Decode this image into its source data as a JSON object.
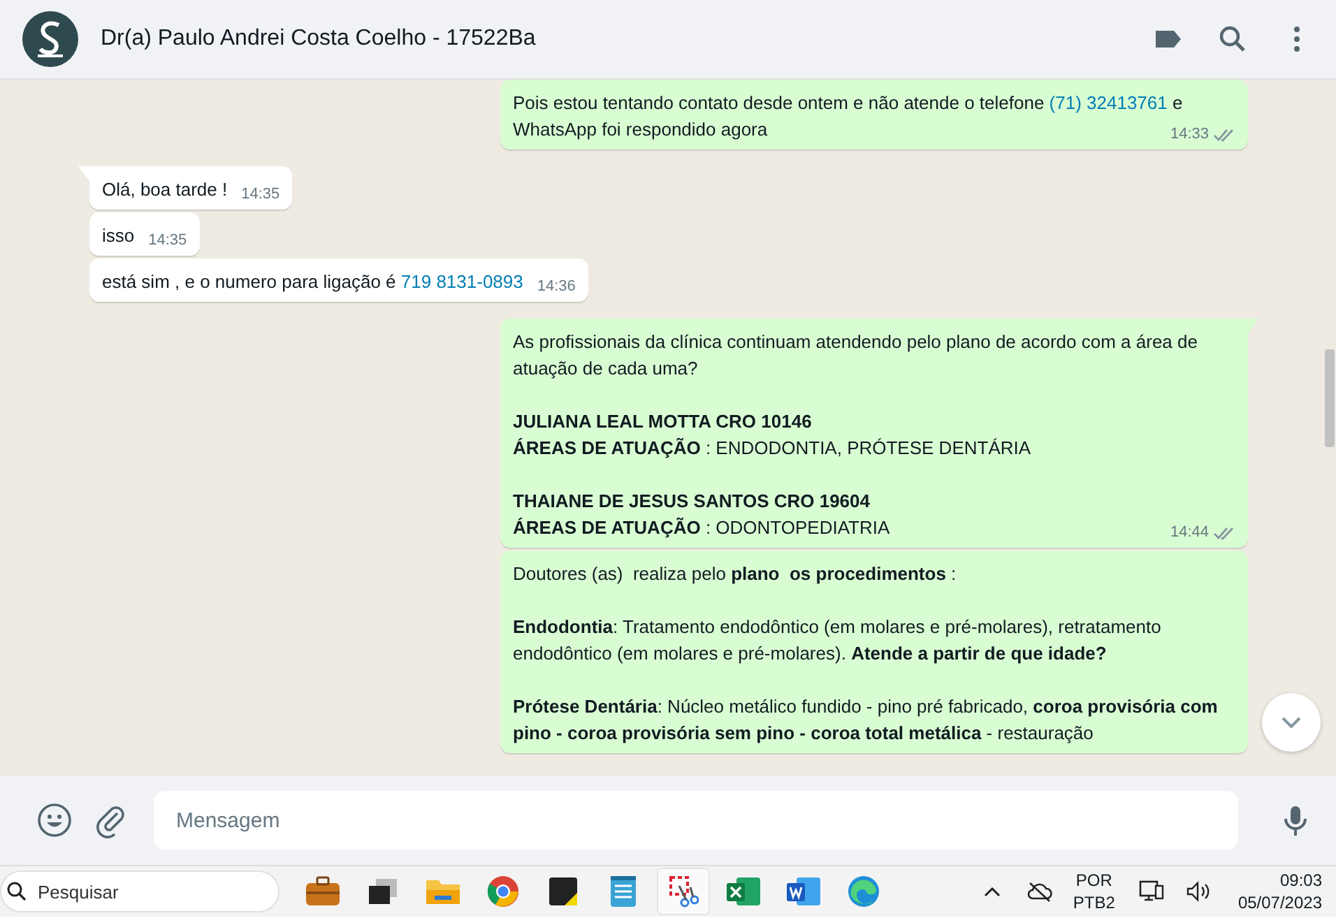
{
  "header": {
    "title": "Dr(a) Paulo Andrei Costa Coelho - 17522Ba"
  },
  "messages": [
    {
      "kind": "sent",
      "tail": false,
      "time": "14:33",
      "paragraphs": [
        [
          {
            "kind": "text",
            "text": "Pois estou tentando contato desde ontem e não atende o telefone "
          },
          {
            "kind": "link",
            "text": "(71) 32413761"
          },
          {
            "kind": "text",
            "text": " e WhatsApp foi respondido agora"
          }
        ]
      ]
    },
    {
      "kind": "received",
      "tail": true,
      "time": "14:35",
      "paragraphs": [
        [
          {
            "kind": "text",
            "text": "Olá, boa tarde !"
          }
        ]
      ]
    },
    {
      "kind": "received",
      "tail": false,
      "time": "14:35",
      "paragraphs": [
        [
          {
            "kind": "text",
            "text": "isso"
          }
        ]
      ]
    },
    {
      "kind": "received",
      "tail": false,
      "time": "14:36",
      "paragraphs": [
        [
          {
            "kind": "text",
            "text": "está sim , e o numero para ligação é "
          },
          {
            "kind": "link",
            "text": "719 8131-0893"
          }
        ]
      ]
    },
    {
      "kind": "sent",
      "tail": true,
      "time": "14:44",
      "paragraphs": [
        [
          {
            "kind": "text",
            "text": "As profissionais da clínica continuam atendendo pelo plano de acordo com a área de atuação de cada uma?"
          }
        ],
        [
          {
            "kind": "text",
            "text": "**JULIANA LEAL MOTTA CRO 10146**"
          }
        ],
        [
          {
            "kind": "text",
            "text": "**ÁREAS DE ATUAÇÃO** : ENDODONTIA, PRÓTESE DENTÁRIA"
          }
        ],
        [
          {
            "kind": "text",
            "text": "**THAIANE DE JESUS SANTOS CRO 19604**"
          }
        ],
        [
          {
            "kind": "text",
            "text": "**ÁREAS DE ATUAÇÃO** : ODONTOPEDIATRIA"
          }
        ]
      ]
    },
    {
      "kind": "sent",
      "tail": false,
      "paragraphs": [
        [
          {
            "kind": "text",
            "text": "Doutores (as)  realiza pelo **plano  os procedimentos** :"
          }
        ],
        [
          {
            "kind": "text",
            "text": "**Endodontia**: Tratamento endodôntico (em molares e pré-molares), retratamento endodôntico (em molares e pré-molares). **Atende a partir de que idade?**"
          }
        ],
        [
          {
            "kind": "text",
            "text": "**Prótese Dentária**: Núcleo metálico fundido - pino pré fabricado, **coroa provisória com pino - coroa provisória sem pino - coroa total metálica** - restauração"
          }
        ]
      ]
    }
  ],
  "composer": {
    "placeholder": "Mensagem"
  },
  "taskbar": {
    "search_placeholder": "Pesquisar",
    "language": "POR",
    "layout": "PTB2",
    "time": "09:03",
    "date": "05/07/2023"
  }
}
